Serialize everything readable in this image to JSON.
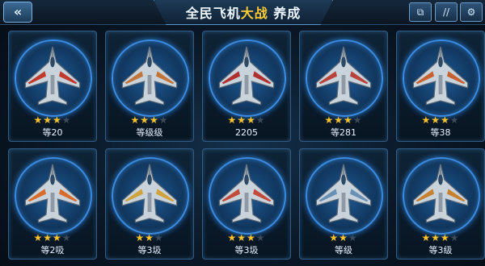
{
  "header": {
    "back_icon": "double-chevron-left-icon",
    "title_prefix": "全民飞机",
    "title_highlight": "大战",
    "title_suffix": " 养成",
    "tools": [
      {
        "icon": "window-icon",
        "glyph": "⧉"
      },
      {
        "icon": "parallel-lines-icon",
        "glyph": "//"
      },
      {
        "icon": "gear-icon",
        "glyph": "⚙"
      }
    ]
  },
  "colors": {
    "star_on": "#ffc42a",
    "star_off": "#3c4a5a",
    "portal_glow": "#3b8be0",
    "title_highlight": "#ffcc33"
  },
  "planes": [
    {
      "label": "等20",
      "stars": 3,
      "max_stars": 4,
      "accent": "#c0392b"
    },
    {
      "label": "等级级",
      "stars": 3,
      "max_stars": 4,
      "accent": "#c4763a"
    },
    {
      "label": "2205",
      "stars": 3,
      "max_stars": 4,
      "accent": "#b03030"
    },
    {
      "label": "等281",
      "stars": 3,
      "max_stars": 4,
      "accent": "#b8433a"
    },
    {
      "label": "等38",
      "stars": 3,
      "max_stars": 4,
      "accent": "#c8612f"
    },
    {
      "label": "等2吸",
      "stars": 3,
      "max_stars": 4,
      "accent": "#d96b2a"
    },
    {
      "label": "等3圾",
      "stars": 2,
      "max_stars": 3,
      "accent": "#d0a23a"
    },
    {
      "label": "等3圾",
      "stars": 3,
      "max_stars": 4,
      "accent": "#c24a3a"
    },
    {
      "label": "等级",
      "stars": 2,
      "max_stars": 3,
      "accent": "#6a8fb5"
    },
    {
      "label": "等3级",
      "stars": 3,
      "max_stars": 4,
      "accent": "#c8802f"
    }
  ]
}
